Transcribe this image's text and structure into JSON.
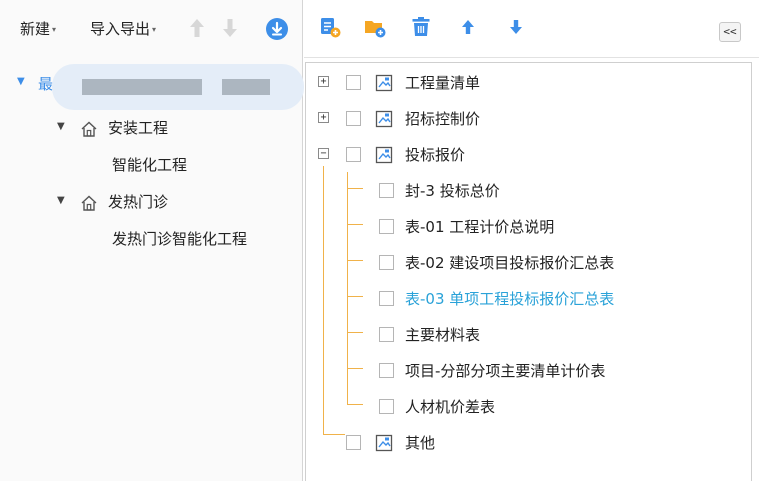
{
  "left_toolbar": {
    "new_label": "新建",
    "import_export_label": "导入导出",
    "up_icon": "arrow-up-icon",
    "down_icon": "arrow-down-icon",
    "download_icon": "download-circle-icon",
    "accent": "#3d8ee8"
  },
  "left_tree": {
    "root_prefix": "最",
    "items": [
      {
        "label": "安装工程",
        "level": 1,
        "type": "folder"
      },
      {
        "label": "智能化工程",
        "level": 2,
        "type": "leaf"
      },
      {
        "label": "发热门诊",
        "level": 1,
        "type": "folder"
      },
      {
        "label": "发热门诊智能化工程",
        "level": 2,
        "type": "leaf"
      }
    ]
  },
  "right_toolbar": {
    "icons": [
      "add-report-icon",
      "add-folder-icon",
      "delete-icon",
      "move-up-icon",
      "move-down-icon"
    ],
    "collapse_label": "<<"
  },
  "right_tree": {
    "items": [
      {
        "label": "工程量清单",
        "expander": "+",
        "folder": true
      },
      {
        "label": "招标控制价",
        "expander": "+",
        "folder": true
      },
      {
        "label": "投标报价",
        "expander": "−",
        "folder": true
      },
      {
        "label": "封-3 投标总价",
        "folder": false
      },
      {
        "label": "表-01 工程计价总说明",
        "folder": false
      },
      {
        "label": "表-02 建设项目投标报价汇总表",
        "folder": false
      },
      {
        "label": "表-03 单项工程投标报价汇总表",
        "folder": false,
        "selected": true
      },
      {
        "label": "主要材料表",
        "folder": false
      },
      {
        "label": "项目-分部分项主要清单计价表",
        "folder": false
      },
      {
        "label": "人材机价差表",
        "folder": false
      },
      {
        "label": "其他",
        "folder": true
      }
    ],
    "selected_color": "#2aa2d8",
    "connector_color": "#f0b24a"
  }
}
